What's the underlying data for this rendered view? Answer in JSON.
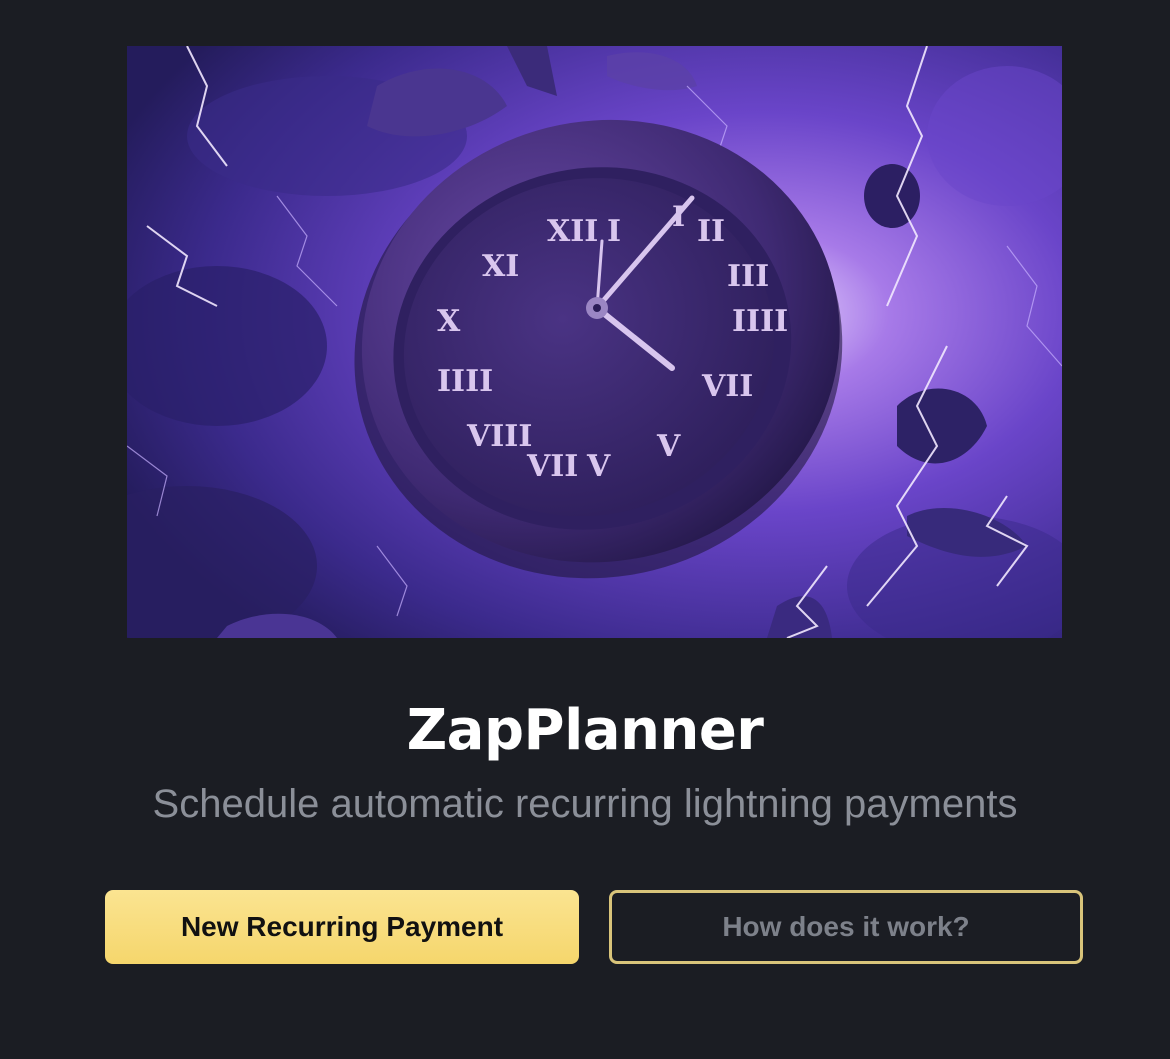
{
  "hero": {
    "image_alt": "Purple clock with Roman numerals surrounded by lightning"
  },
  "app": {
    "title": "ZapPlanner",
    "subtitle": "Schedule automatic recurring lightning payments"
  },
  "actions": {
    "primary_label": "New Recurring Payment",
    "secondary_label": "How does it work?"
  },
  "colors": {
    "background": "#1b1d23",
    "primary_button": "#f8dc7c",
    "secondary_border": "#d9c47a",
    "subtitle_text": "#8b8f98"
  }
}
